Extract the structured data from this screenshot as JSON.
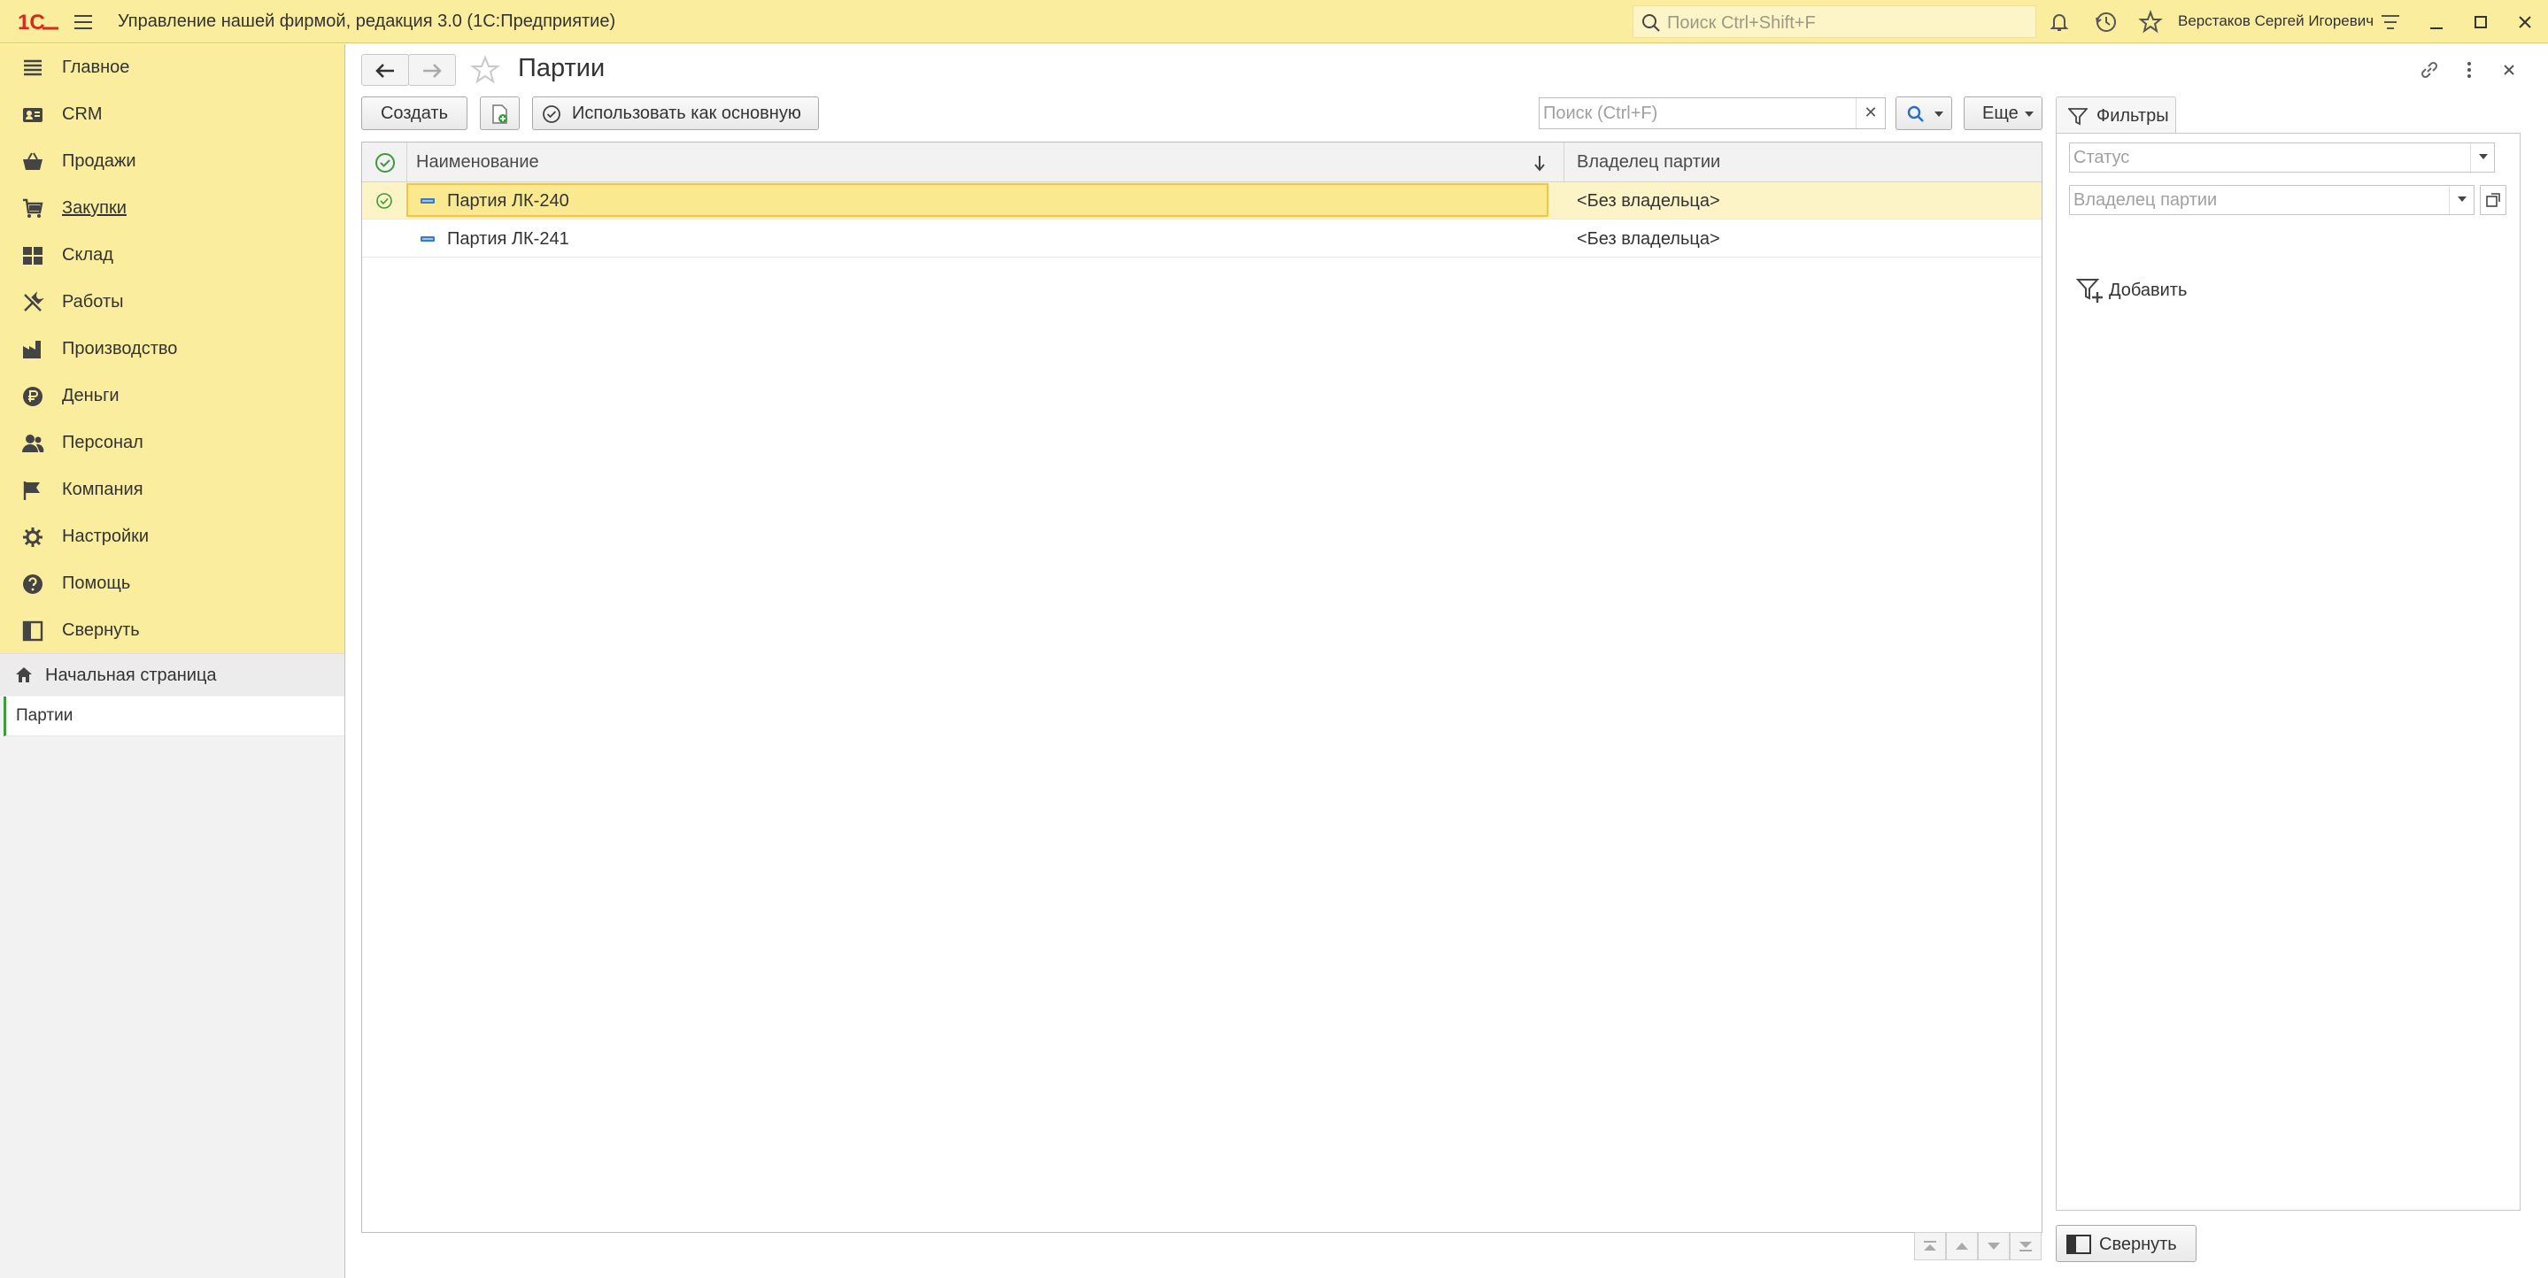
{
  "titlebar": {
    "app_title": "Управление нашей фирмой, редакция 3.0  (1С:Предприятие)",
    "search_placeholder": "Поиск Ctrl+Shift+F",
    "user_name": "Верстаков Сергей Игоревич"
  },
  "sidebar": {
    "items": [
      {
        "label": "Главное",
        "icon": "list-icon"
      },
      {
        "label": "CRM",
        "icon": "contact-card-icon"
      },
      {
        "label": "Продажи",
        "icon": "basket-icon"
      },
      {
        "label": "Закупки",
        "icon": "cart-icon"
      },
      {
        "label": "Склад",
        "icon": "warehouse-icon"
      },
      {
        "label": "Работы",
        "icon": "tools-icon"
      },
      {
        "label": "Производство",
        "icon": "factory-icon"
      },
      {
        "label": "Деньги",
        "icon": "ruble-icon"
      },
      {
        "label": "Персонал",
        "icon": "people-icon"
      },
      {
        "label": "Компания",
        "icon": "flag-icon"
      },
      {
        "label": "Настройки",
        "icon": "gear-icon"
      },
      {
        "label": "Помощь",
        "icon": "help-icon"
      },
      {
        "label": "Свернуть",
        "icon": "collapse-panel-icon"
      }
    ],
    "home_label": "Начальная страница",
    "open_page_label": "Партии"
  },
  "form": {
    "title": "Партии",
    "toolbar": {
      "create_label": "Создать",
      "use_as_main_label": "Использовать как основную",
      "search_placeholder": "Поиск (Ctrl+F)",
      "more_label": "Еще"
    },
    "table": {
      "columns": [
        "Наименование",
        "Владелец партии"
      ],
      "rows": [
        {
          "name": "Партия ЛК-240",
          "owner": "<Без владельца>",
          "is_main": true,
          "selected": true
        },
        {
          "name": "Партия ЛК-241",
          "owner": "<Без владельца>",
          "is_main": false,
          "selected": false
        }
      ]
    },
    "filters": {
      "tab_label": "Фильтры",
      "status_placeholder": "Статус",
      "owner_placeholder": "Владелец партии",
      "add_label": "Добавить"
    },
    "collapse_label": "Свернуть"
  },
  "colors": {
    "accent_yellow": "#fbed9e",
    "selection": "#fbe98f",
    "logo_red": "#d52b1e",
    "main_marker_green": "#3c9b3c"
  }
}
